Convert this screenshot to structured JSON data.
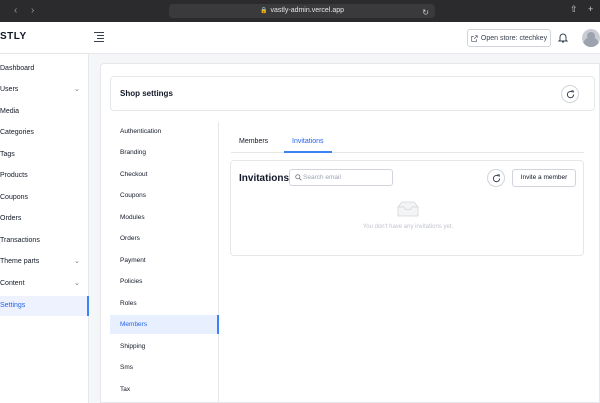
{
  "browser": {
    "url": "vastly-admin.vercel.app"
  },
  "topbar": {
    "logo": "STLY",
    "open_store_label": "Open store: ctechkey"
  },
  "sidebar": {
    "items": [
      {
        "label": "Dashboard",
        "has_chevron": false,
        "active": false
      },
      {
        "label": "Users",
        "has_chevron": true,
        "active": false
      },
      {
        "label": "Media",
        "has_chevron": false,
        "active": false
      },
      {
        "label": "Categories",
        "has_chevron": false,
        "active": false
      },
      {
        "label": "Tags",
        "has_chevron": false,
        "active": false
      },
      {
        "label": "Products",
        "has_chevron": false,
        "active": false
      },
      {
        "label": "Coupons",
        "has_chevron": false,
        "active": false
      },
      {
        "label": "Orders",
        "has_chevron": false,
        "active": false
      },
      {
        "label": "Transactions",
        "has_chevron": false,
        "active": false
      },
      {
        "label": "Theme parts",
        "has_chevron": true,
        "active": false
      },
      {
        "label": "Content",
        "has_chevron": true,
        "active": false
      },
      {
        "label": "Settings",
        "has_chevron": false,
        "active": true
      }
    ]
  },
  "header": {
    "title": "Shop settings"
  },
  "settings_nav": {
    "items": [
      {
        "label": "Authentication",
        "active": false
      },
      {
        "label": "Branding",
        "active": false
      },
      {
        "label": "Checkout",
        "active": false
      },
      {
        "label": "Coupons",
        "active": false
      },
      {
        "label": "Modules",
        "active": false
      },
      {
        "label": "Orders",
        "active": false
      },
      {
        "label": "Payment",
        "active": false
      },
      {
        "label": "Policies",
        "active": false
      },
      {
        "label": "Roles",
        "active": false
      },
      {
        "label": "Members",
        "active": true
      },
      {
        "label": "Shipping",
        "active": false
      },
      {
        "label": "Sms",
        "active": false
      },
      {
        "label": "Tax",
        "active": false
      }
    ]
  },
  "tabs": {
    "members": "Members",
    "invitations": "Invitations",
    "active": "invitations"
  },
  "invitations": {
    "title": "Invitations",
    "search_placeholder": "Search email",
    "invite_label": "Invite a member",
    "empty_text": "You don't have any invitations yet."
  },
  "colors": {
    "accent": "#2563eb",
    "active_bg": "#e8efff"
  }
}
